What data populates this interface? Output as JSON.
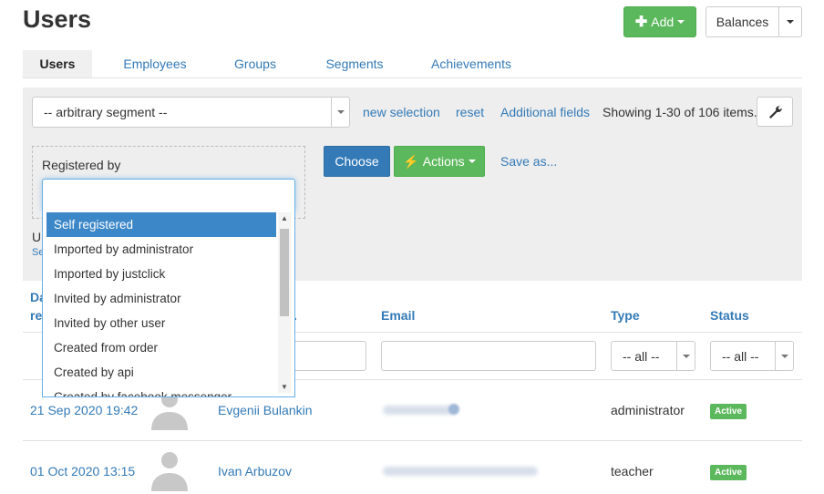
{
  "page": {
    "title": "Users"
  },
  "header": {
    "add_label": "Add",
    "balances_label": "Balances"
  },
  "tabs": [
    {
      "label": "Users",
      "active": true
    },
    {
      "label": "Employees"
    },
    {
      "label": "Groups"
    },
    {
      "label": "Segments"
    },
    {
      "label": "Achievements"
    }
  ],
  "filter": {
    "segment_select": "-- arbitrary segment --",
    "new_selection": "new selection",
    "reset": "reset",
    "additional_fields": "Additional fields",
    "showing": "Showing 1-30 of 106 items.",
    "registered_by_label": "Registered by",
    "choose_label": "Choose",
    "actions_label": "Actions",
    "save_as_label": "Save as..."
  },
  "dropdown": {
    "options": [
      "Self registered",
      "Imported by administrator",
      "Imported by justclick",
      "Invited by administrator",
      "Invited by other user",
      "Created from order",
      "Created by api",
      "Created by facebook messenger"
    ],
    "selected": "Self registered"
  },
  "partial": {
    "under_dropdown_a": "U",
    "under_dropdown_b": "Se"
  },
  "table": {
    "columns": {
      "date_part1": "Da",
      "date_part2": "re",
      "name_fragment": ".",
      "email": "Email",
      "type": "Type",
      "status": "Status"
    },
    "type_filter": "-- all --",
    "status_filter": "-- all --",
    "rows": [
      {
        "date": "21 Sep 2020 19:42",
        "name": "Evgenii Bulankin",
        "type": "administrator",
        "status": "Active"
      },
      {
        "date": "01 Oct 2020 13:15",
        "name": "Ivan Arbuzov",
        "type": "teacher",
        "status": "Active"
      }
    ]
  },
  "colors": {
    "primary": "#337ab7",
    "success": "#5cb85c",
    "panel": "#eeeeee"
  }
}
